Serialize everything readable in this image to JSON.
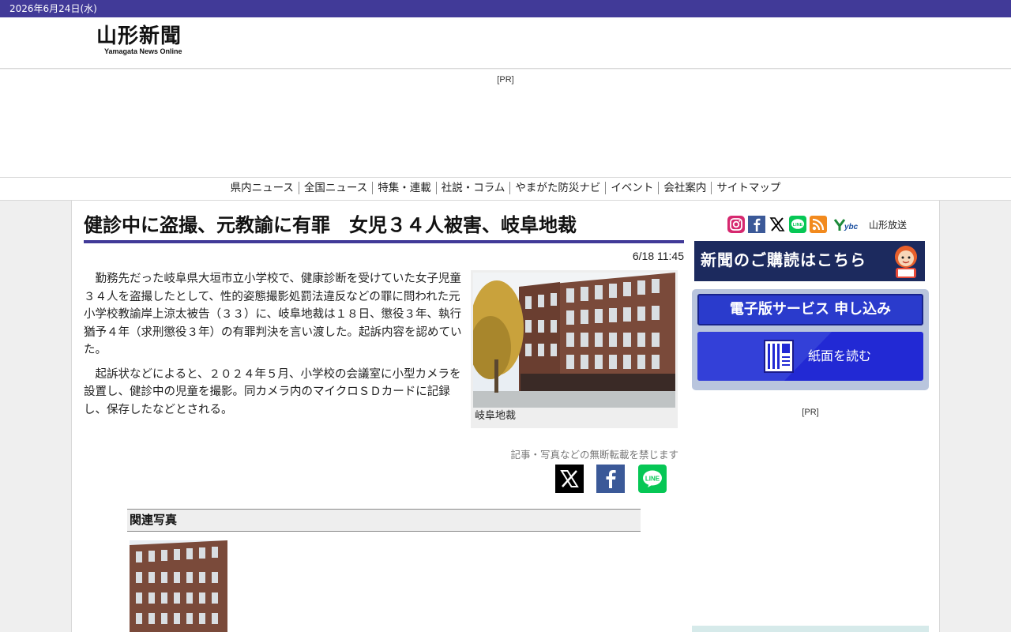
{
  "topbar": {
    "date": "2026年6月24日(水)"
  },
  "header": {
    "logo_jp": "山形新聞",
    "logo_en": "Yamagata News Online"
  },
  "top_ad": {
    "label": "[PR]"
  },
  "nav": {
    "items": [
      {
        "label": "県内ニュース"
      },
      {
        "label": "全国ニュース"
      },
      {
        "label": "特集・連載"
      },
      {
        "label": "社説・コラム"
      },
      {
        "label": "やまがた防災ナビ"
      },
      {
        "label": "イベント"
      },
      {
        "label": "会社案内"
      },
      {
        "label": "サイトマップ"
      }
    ]
  },
  "article": {
    "headline": "健診中に盗撮、元教諭に有罪　女児３４人被害、岐阜地裁",
    "timestamp": "6/18 11:45",
    "paragraphs": [
      "勤務先だった岐阜県大垣市立小学校で、健康診断を受けていた女子児童３４人を盗撮したとして、性的姿態撮影処罰法違反などの罪に問われた元小学校教諭岸上涼太被告（３３）に、岐阜地裁は１８日、懲役３年、執行猶予４年（求刑懲役３年）の有罪判決を言い渡した。起訴内容を認めていた。",
      "起訴状などによると、２０２４年５月、小学校の会議室に小型カメラを設置し、健診中の児童を撮影。同カメラ内のマイクロＳＤカードに記録し、保存したなどとされる。"
    ],
    "photo_caption": "岐阜地裁",
    "copyright": "記事・写真などの無断転載を禁じます",
    "share": [
      "x-icon",
      "facebook-icon",
      "line-icon"
    ],
    "related_title": "関連写真"
  },
  "sidebar": {
    "sns_icons": [
      "instagram-icon",
      "facebook-icon",
      "x-icon",
      "line-icon",
      "rss-icon"
    ],
    "ybc_label": "山形放送",
    "subscribe_label": "新聞のご購読はこちら",
    "digital_label": "電子版サービス 申し込み",
    "paper_label": "紙面を読む",
    "ad_label": "[PR]"
  },
  "colors": {
    "brand": "#413a98",
    "subscribe_bg": "#1c2a5e",
    "digital_button": "#2a3bcc",
    "digital_panel": "#b9c5dd"
  }
}
